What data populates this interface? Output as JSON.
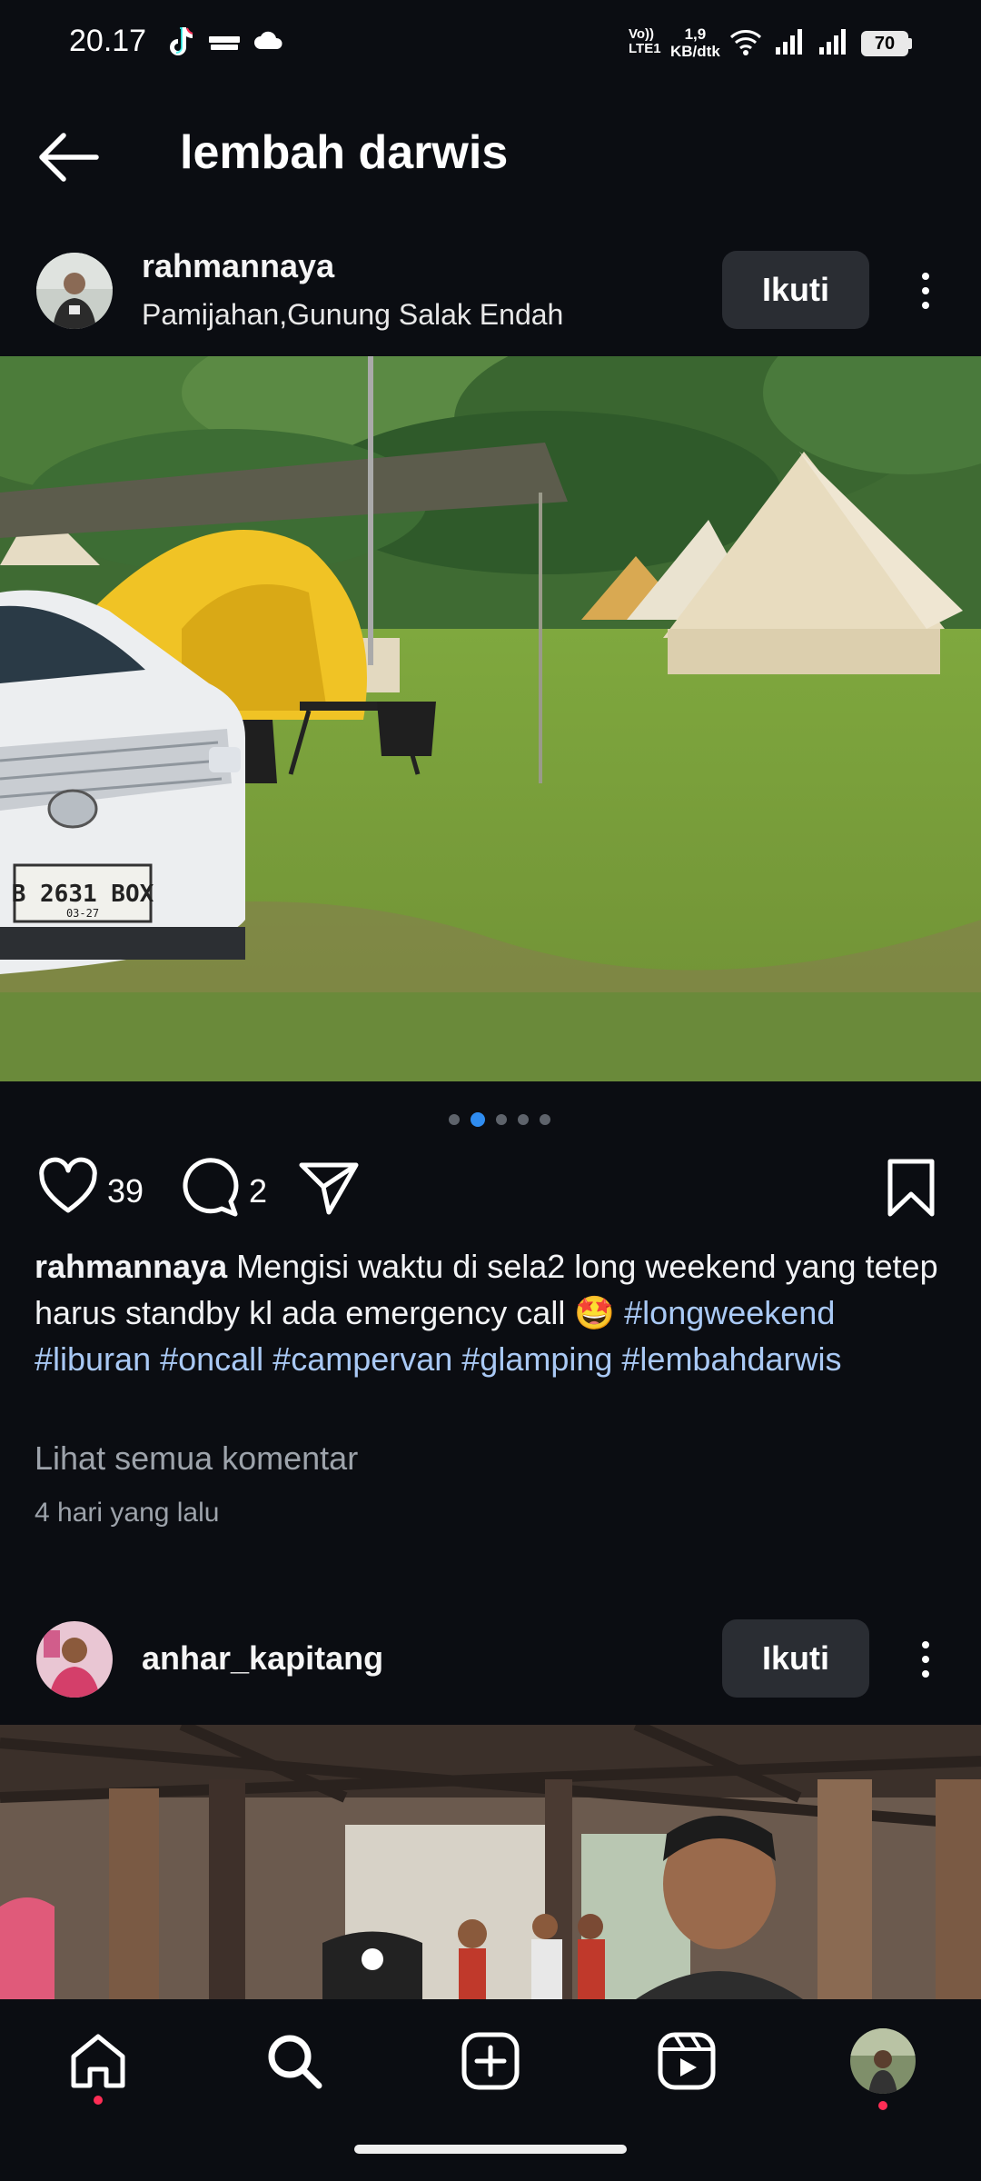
{
  "status_bar": {
    "time": "20.17",
    "network_speed_value": "1,9",
    "network_speed_unit": "KB/dtk",
    "volte_top": "Vo))",
    "volte_bottom": "LTE1",
    "battery": "70",
    "icons": [
      "tiktok-icon",
      "royal-match-icon",
      "cloud-icon",
      "wifi-icon",
      "signal-icon",
      "signal-icon"
    ]
  },
  "header": {
    "title": "lembah darwis",
    "back_icon": "arrow-left-icon"
  },
  "posts": [
    {
      "username": "rahmannaya",
      "location": "Pamijahan,Gunung Salak Endah",
      "follow_label": "Ikuti",
      "image_description_label": "",
      "carousel": {
        "count": 5,
        "active_index": 1
      },
      "likes": "39",
      "comments": "2",
      "caption_user": "rahmannaya",
      "caption_text": " Mengisi waktu di sela2  long weekend yang tetep harus standby kl ada emergency call 🤩",
      "hashtags": "#longweekend #liburan #oncall #campervan #glamping #lembahdarwis",
      "view_comments": "Lihat semua komentar",
      "time_ago": "4 hari yang lalu",
      "car_plate": "B 2631 BOX",
      "car_plate_sub": "03-27"
    },
    {
      "username": "anhar_kapitang",
      "follow_label": "Ikuti"
    }
  ],
  "bottom_nav": {
    "items": [
      "home-icon",
      "search-icon",
      "create-icon",
      "reels-icon",
      "profile-avatar"
    ]
  },
  "colors": {
    "background": "#0b0d12",
    "button": "#2a2d33",
    "hashtag": "#a9c9f5",
    "active_dot": "#2f8cf0",
    "notification_dot": "#ff2d55"
  }
}
